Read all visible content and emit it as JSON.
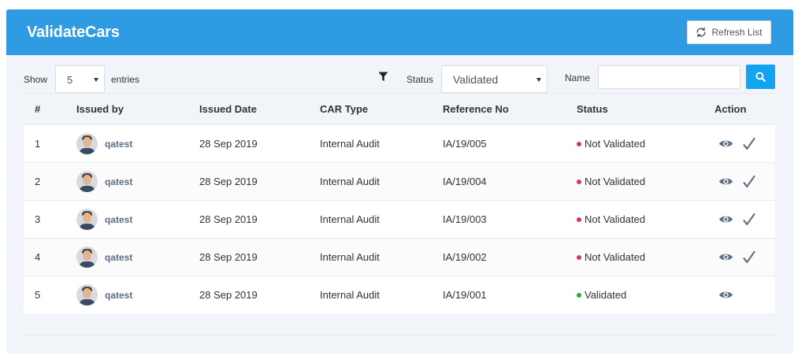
{
  "header": {
    "title": "ValidateCars",
    "refresh_label": "Refresh List"
  },
  "controls": {
    "show_label": "Show",
    "entries_value": "5",
    "entries_label": "entries",
    "status_label": "Status",
    "status_value": "Validated",
    "name_label": "Name",
    "name_value": ""
  },
  "table": {
    "columns": [
      "#",
      "Issued by",
      "Issued Date",
      "CAR Type",
      "Reference No",
      "Status",
      "Action"
    ],
    "rows": [
      {
        "num": "1",
        "issued_by": "qatest",
        "date": "28 Sep 2019",
        "type": "Internal Audit",
        "ref": "IA/19/005",
        "status": "Not Validated",
        "validate_action": true
      },
      {
        "num": "2",
        "issued_by": "qatest",
        "date": "28 Sep 2019",
        "type": "Internal Audit",
        "ref": "IA/19/004",
        "status": "Not Validated",
        "validate_action": true
      },
      {
        "num": "3",
        "issued_by": "qatest",
        "date": "28 Sep 2019",
        "type": "Internal Audit",
        "ref": "IA/19/003",
        "status": "Not Validated",
        "validate_action": true
      },
      {
        "num": "4",
        "issued_by": "qatest",
        "date": "28 Sep 2019",
        "type": "Internal Audit",
        "ref": "IA/19/002",
        "status": "Not Validated",
        "validate_action": true
      },
      {
        "num": "5",
        "issued_by": "qatest",
        "date": "28 Sep 2019",
        "type": "Internal Audit",
        "ref": "IA/19/001",
        "status": "Validated",
        "validate_action": false
      }
    ]
  },
  "colors": {
    "header_bg": "#2e9be3",
    "search_button": "#12a4ef",
    "status_not_validated": "#d9364f",
    "status_validated": "#27a844",
    "action_icon": "#5d6d82"
  },
  "icons": {
    "refresh": "refresh-icon",
    "filter": "filter-icon",
    "search": "search-icon",
    "view": "eye-icon",
    "validate": "check-icon"
  }
}
